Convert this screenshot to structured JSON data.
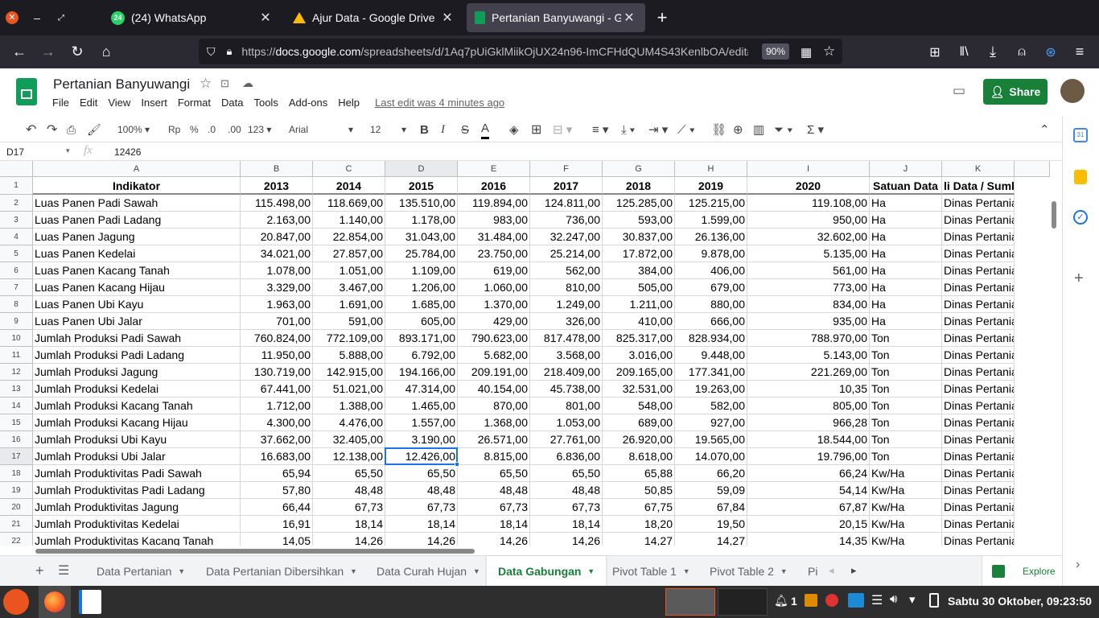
{
  "browser": {
    "tabs": [
      {
        "title": "(24) WhatsApp",
        "badge": "24"
      },
      {
        "title": "Ajur Data - Google Drive"
      },
      {
        "title": "Pertanian Banyuwangi - Goo"
      }
    ],
    "url_domain": "docs.google.com",
    "url_prefix": "https://",
    "url_rest": "/spreadsheets/d/1Aq7pUiGklMiikOjUX24n96-ImCFHdQUM4S43KenlbOA/edit#",
    "zoom": "90%"
  },
  "sheet": {
    "title": "Pertanian Banyuwangi",
    "menus": [
      "File",
      "Edit",
      "View",
      "Insert",
      "Format",
      "Data",
      "Tools",
      "Add-ons",
      "Help"
    ],
    "last_edit": "Last edit was 4 minutes ago",
    "share_label": "Share",
    "toolbar": {
      "zoom": "100%",
      "currency": "Rp",
      "percent": "%",
      "dec_less": ".0",
      "dec_more": ".00",
      "format": "123",
      "font": "Arial",
      "size": "12"
    },
    "name_box": "D17",
    "formula": "12426",
    "columns": [
      "A",
      "B",
      "C",
      "D",
      "E",
      "F",
      "G",
      "H",
      "I",
      "J",
      "K"
    ],
    "header_row": [
      "Indikator",
      "2013",
      "2014",
      "2015",
      "2016",
      "2017",
      "2018",
      "2019",
      "2020",
      "Satuan Data",
      "li Data / Sumber"
    ],
    "rows": [
      [
        "Luas Panen Padi Sawah",
        "115.498,00",
        "118.669,00",
        "135.510,00",
        "119.894,00",
        "124.811,00",
        "125.285,00",
        "125.215,00",
        "119.108,00",
        "Ha",
        "Dinas Pertanian dan"
      ],
      [
        "Luas Panen Padi Ladang",
        "2.163,00",
        "1.140,00",
        "1.178,00",
        "983,00",
        "736,00",
        "593,00",
        "1.599,00",
        "950,00",
        "Ha",
        "Dinas Pertanian dan"
      ],
      [
        "Luas Panen Jagung",
        "20.847,00",
        "22.854,00",
        "31.043,00",
        "31.484,00",
        "32.247,00",
        "30.837,00",
        "26.136,00",
        "32.602,00",
        "Ha",
        "Dinas Pertanian dan"
      ],
      [
        "Luas Panen Kedelai",
        "34.021,00",
        "27.857,00",
        "25.784,00",
        "23.750,00",
        "25.214,00",
        "17.872,00",
        "9.878,00",
        "5.135,00",
        "Ha",
        "Dinas Pertanian dan"
      ],
      [
        "Luas Panen Kacang Tanah",
        "1.078,00",
        "1.051,00",
        "1.109,00",
        "619,00",
        "562,00",
        "384,00",
        "406,00",
        "561,00",
        "Ha",
        "Dinas Pertanian dan"
      ],
      [
        "Luas Panen Kacang Hijau",
        "3.329,00",
        "3.467,00",
        "1.206,00",
        "1.060,00",
        "810,00",
        "505,00",
        "679,00",
        "773,00",
        "Ha",
        "Dinas Pertanian dan"
      ],
      [
        "Luas Panen Ubi Kayu",
        "1.963,00",
        "1.691,00",
        "1.685,00",
        "1.370,00",
        "1.249,00",
        "1.211,00",
        "880,00",
        "834,00",
        "Ha",
        "Dinas Pertanian dan"
      ],
      [
        "Luas Panen Ubi Jalar",
        "701,00",
        "591,00",
        "605,00",
        "429,00",
        "326,00",
        "410,00",
        "666,00",
        "935,00",
        "Ha",
        "Dinas Pertanian dan"
      ],
      [
        "Jumlah Produksi Padi Sawah",
        "760.824,00",
        "772.109,00",
        "893.171,00",
        "790.623,00",
        "817.478,00",
        "825.317,00",
        "828.934,00",
        "788.970,00",
        "Ton",
        "Dinas Pertanian dan"
      ],
      [
        "Jumlah Produksi Padi Ladang",
        "11.950,00",
        "5.888,00",
        "6.792,00",
        "5.682,00",
        "3.568,00",
        "3.016,00",
        "9.448,00",
        "5.143,00",
        "Ton",
        "Dinas Pertanian dan"
      ],
      [
        "Jumlah Produksi Jagung",
        "130.719,00",
        "142.915,00",
        "194.166,00",
        "209.191,00",
        "218.409,00",
        "209.165,00",
        "177.341,00",
        "221.269,00",
        "Ton",
        "Dinas Pertanian dan"
      ],
      [
        "Jumlah Produksi Kedelai",
        "67.441,00",
        "51.021,00",
        "47.314,00",
        "40.154,00",
        "45.738,00",
        "32.531,00",
        "19.263,00",
        "10,35",
        "Ton",
        "Dinas Pertanian dan"
      ],
      [
        "Jumlah Produksi Kacang Tanah",
        "1.712,00",
        "1.388,00",
        "1.465,00",
        "870,00",
        "801,00",
        "548,00",
        "582,00",
        "805,00",
        "Ton",
        "Dinas Pertanian dan"
      ],
      [
        "Jumlah Produksi Kacang Hijau",
        "4.300,00",
        "4.476,00",
        "1.557,00",
        "1.368,00",
        "1.053,00",
        "689,00",
        "927,00",
        "966,28",
        "Ton",
        "Dinas Pertanian dan"
      ],
      [
        "Jumlah Produksi Ubi Kayu",
        "37.662,00",
        "32.405,00",
        "3.190,00",
        "26.571,00",
        "27.761,00",
        "26.920,00",
        "19.565,00",
        "18.544,00",
        "Ton",
        "Dinas Pertanian dan"
      ],
      [
        "Jumlah Produksi Ubi Jalar",
        "16.683,00",
        "12.138,00",
        "12.426,00",
        "8.815,00",
        "6.836,00",
        "8.618,00",
        "14.070,00",
        "19.796,00",
        "Ton",
        "Dinas Pertanian dan"
      ],
      [
        "Jumlah Produktivitas Padi Sawah",
        "65,94",
        "65,50",
        "65,50",
        "65,50",
        "65,50",
        "65,88",
        "66,20",
        "66,24",
        "Kw/Ha",
        "Dinas Pertanian dan"
      ],
      [
        "Jumlah Produktivitas Padi Ladang",
        "57,80",
        "48,48",
        "48,48",
        "48,48",
        "48,48",
        "50,85",
        "59,09",
        "54,14",
        "Kw/Ha",
        "Dinas Pertanian dan"
      ],
      [
        "Jumlah Produktivitas Jagung",
        "66,44",
        "67,73",
        "67,73",
        "67,73",
        "67,73",
        "67,75",
        "67,84",
        "67,87",
        "Kw/Ha",
        "Dinas Pertanian dan"
      ],
      [
        "Jumlah Produktivitas Kedelai",
        "16,91",
        "18,14",
        "18,14",
        "18,14",
        "18,14",
        "18,20",
        "19,50",
        "20,15",
        "Kw/Ha",
        "Dinas Pertanian dan"
      ],
      [
        "Jumlah Produktivitas Kacang Tanah",
        "14,05",
        "14,26",
        "14,26",
        "14,26",
        "14,26",
        "14,27",
        "14,27",
        "14,35",
        "Kw/Ha",
        "Dinas Pertanian dan"
      ]
    ],
    "row_numbers": [
      "1",
      "2",
      "3",
      "4",
      "5",
      "6",
      "7",
      "8",
      "9",
      "10",
      "11",
      "12",
      "13",
      "14",
      "15",
      "16",
      "17",
      "18",
      "19",
      "20",
      "21",
      "22"
    ],
    "sheet_tabs": [
      "Data Pertanian",
      "Data Pertanian Dibersihkan",
      "Data Curah Hujan",
      "Data Gabungan",
      "Pivot Table 1",
      "Pivot Table 2",
      "Pi"
    ],
    "active_sheet": "Data Gabungan",
    "explore_label": "Explore"
  },
  "taskbar": {
    "workspace": "1",
    "clock": "Sabtu 30 Oktober, 09:23:50"
  },
  "colors": {
    "accent": "#188038",
    "selection": "#1a73e8"
  }
}
